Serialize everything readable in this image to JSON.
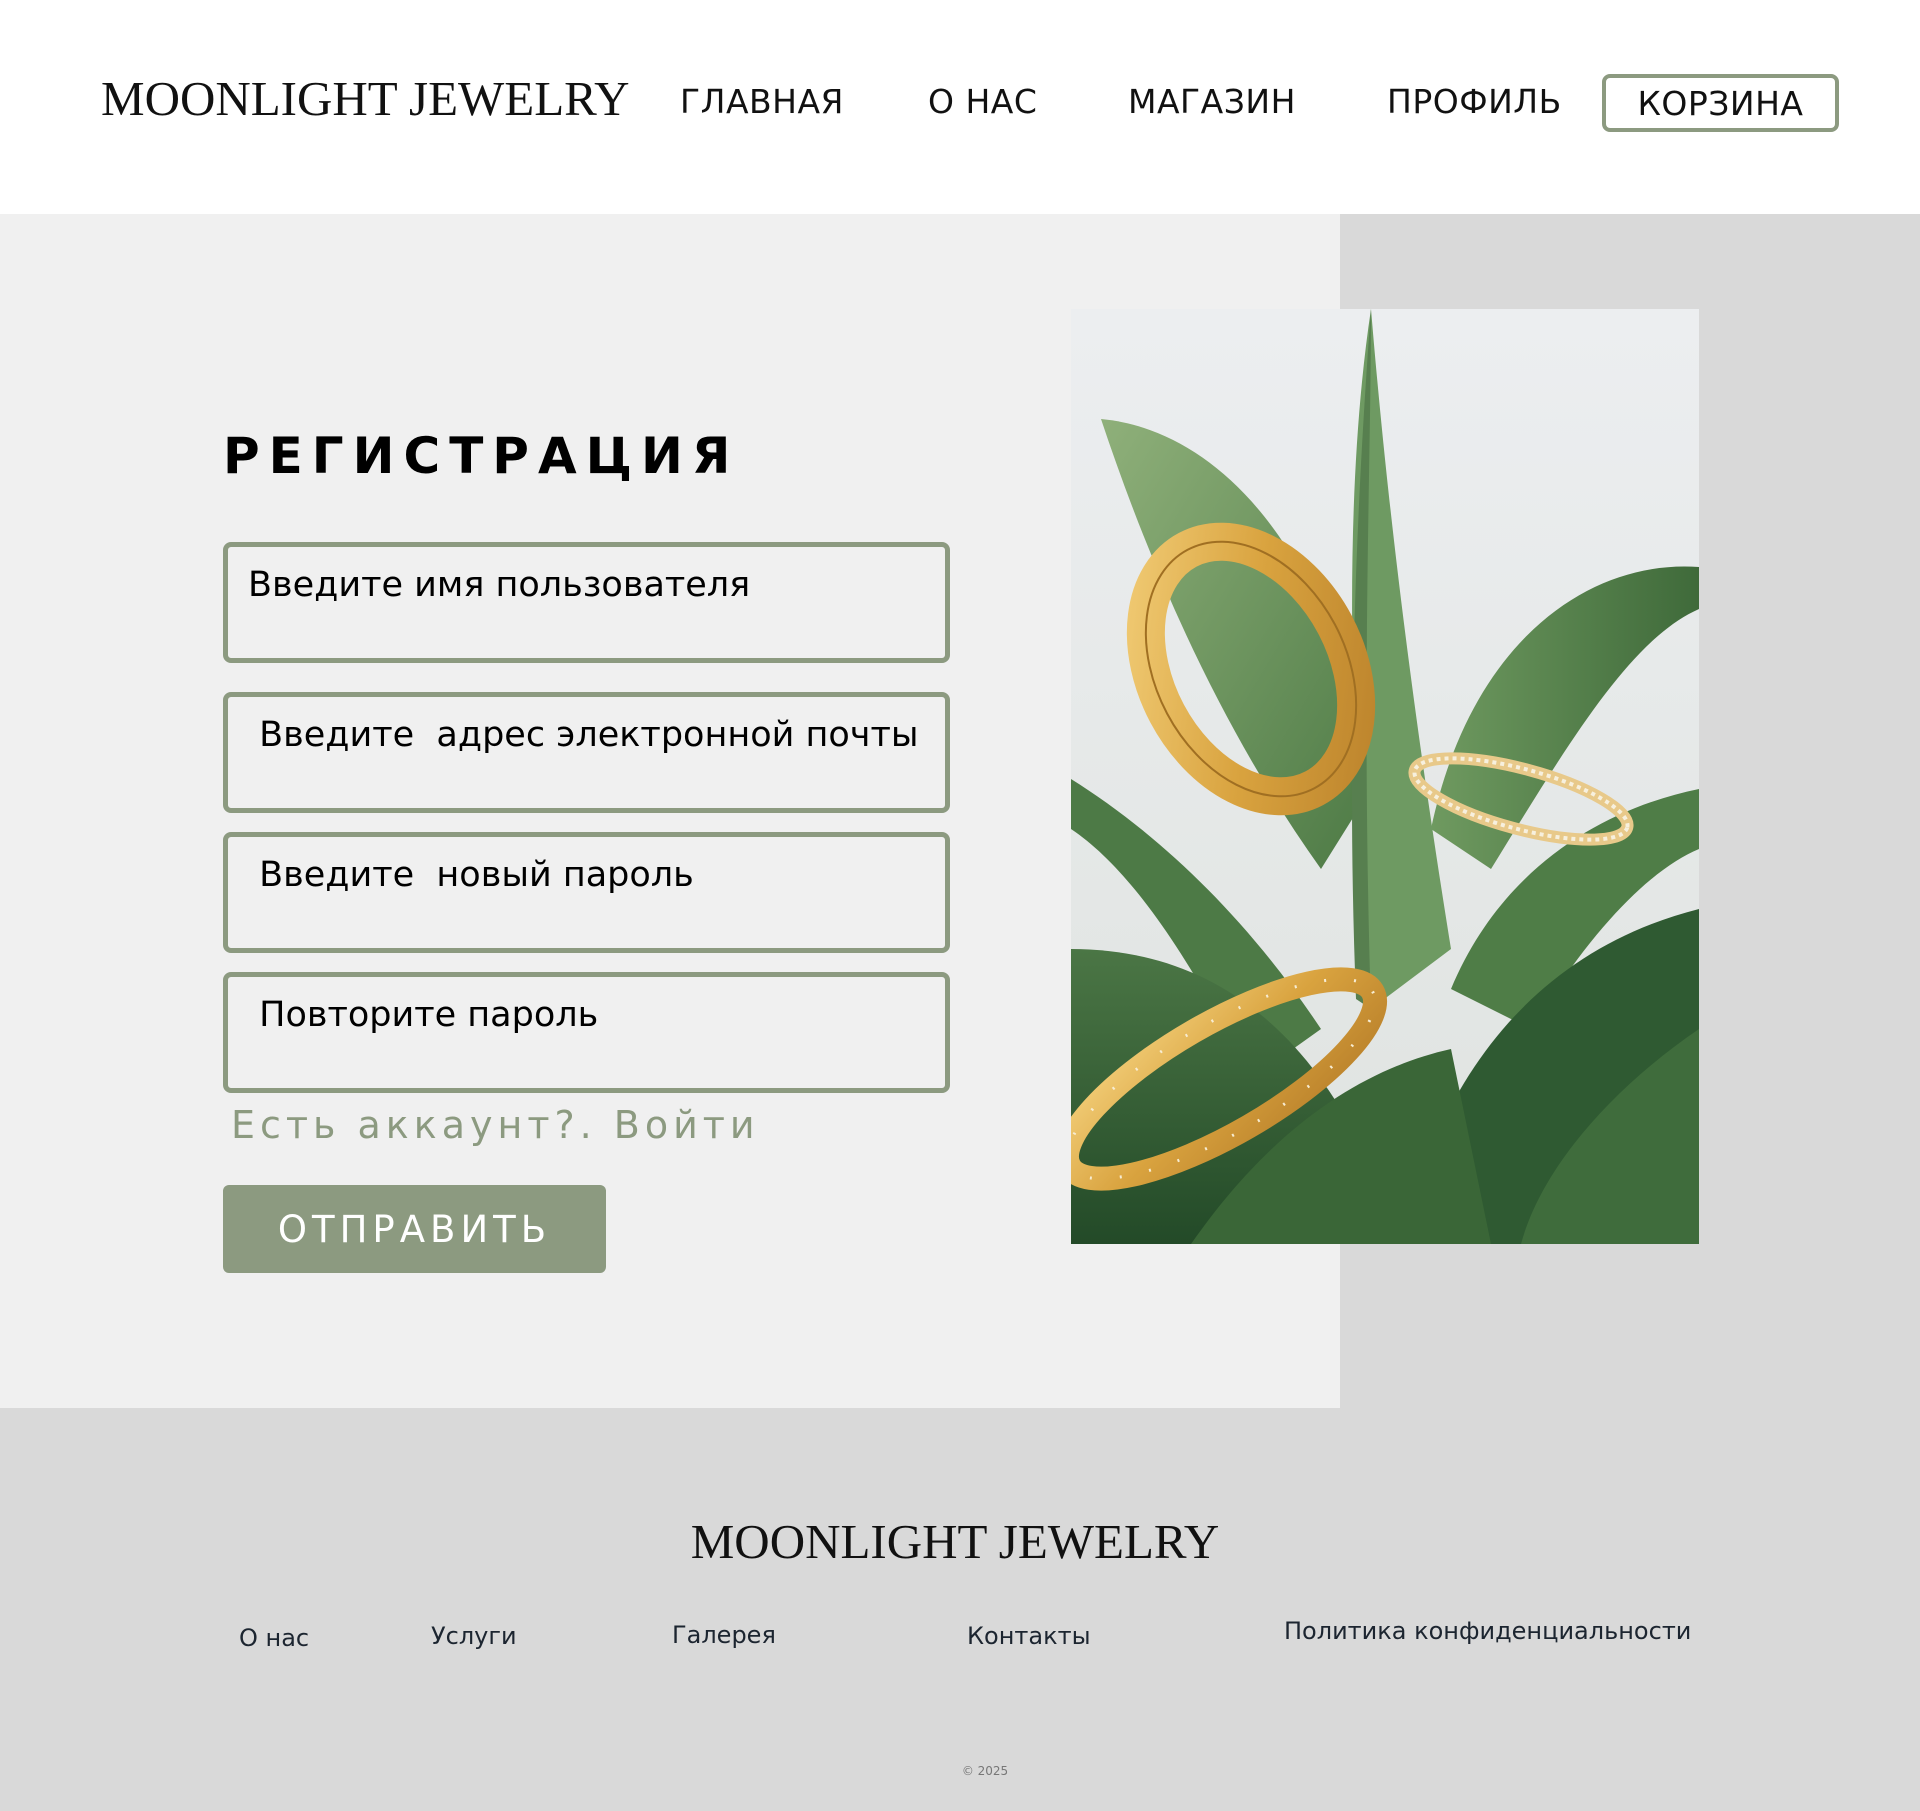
{
  "header": {
    "logo": "MOONLIGHT JEWELRY",
    "nav": {
      "home": "ГЛАВНАЯ",
      "about": "О НАС",
      "shop": "МАГАЗИН",
      "profile": "ПРОФИЛЬ",
      "cart": "КОРЗИНА"
    }
  },
  "form": {
    "title": "РЕГИСТРАЦИЯ",
    "fields": {
      "username": {
        "value": "",
        "placeholder": "Введите имя пользователя"
      },
      "email": {
        "value": "",
        "placeholder": " Введите  адрес электронной почты"
      },
      "password": {
        "value": "",
        "placeholder": " Введите  новый пароль"
      },
      "password_repeat": {
        "value": "",
        "placeholder": " Повторите пароль"
      }
    },
    "login_hint": "Есть аккаунт?. Войти",
    "submit_label": "ОТПРАВИТЬ"
  },
  "footer": {
    "logo": "MOONLIGHT JEWELRY",
    "links": {
      "about": "О нас",
      "services": "Услуги",
      "gallery": "Галерея",
      "contacts": "Контакты",
      "privacy": "Политика конфиденциальности"
    },
    "copyright": "© 2025"
  },
  "colors": {
    "accent": "#8c9a80",
    "panel_light": "#f0f0f0",
    "panel_grey": "#d9d9d9",
    "footer_text": "#1c2530"
  }
}
